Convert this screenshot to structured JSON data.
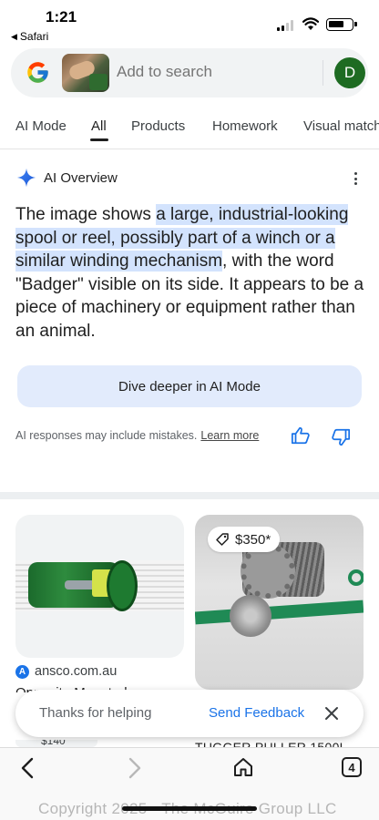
{
  "status_bar": {
    "time": "1:21",
    "back_app": "Safari"
  },
  "search": {
    "placeholder": "Add to search",
    "avatar_initial": "D"
  },
  "tabs": [
    {
      "label": "AI Mode",
      "active": false
    },
    {
      "label": "All",
      "active": true
    },
    {
      "label": "Products",
      "active": false
    },
    {
      "label": "Homework",
      "active": false
    },
    {
      "label": "Visual matches",
      "active": false
    }
  ],
  "ai_overview": {
    "title": "AI Overview",
    "text_before": "The image shows ",
    "text_highlight": "a large, industrial-looking spool or reel, possibly part of a winch or a similar winding mechanism",
    "text_after": ", with the word \"Badger\" visible on its side. It appears to be a piece of machinery or equipment rather than an animal.",
    "dive_button": "Dive deeper in AI Mode",
    "disclaimer": "AI responses may include mistakes.",
    "learn_more": "Learn more"
  },
  "results": {
    "left": {
      "source": "ansco.com.au",
      "title_cut": "Opposite Mounted...",
      "badge_cut": "$140"
    },
    "right": {
      "price": "$350*",
      "title_cut": "TUGGER PULLER 1500L"
    }
  },
  "toast": {
    "message": "Thanks for helping",
    "action": "Send Feedback"
  },
  "bottom_bar": {
    "tab_count": "4"
  },
  "watermark": "Copyright 2025 - The McGuire Group LLC",
  "colors": {
    "accent_blue": "#1a73e8",
    "highlight": "#d3e3fd",
    "avatar_green": "#1e6b22",
    "dive_button_bg": "#e2ebfc"
  }
}
